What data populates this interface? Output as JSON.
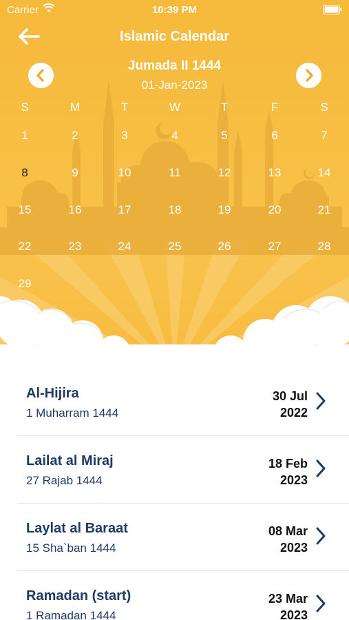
{
  "status": {
    "carrier": "Carrier",
    "time": "10:39 PM"
  },
  "header": {
    "title": "Islamic Calendar"
  },
  "month": {
    "hijri": "Jumada II 1444",
    "gregorian": "01-Jan-2023"
  },
  "weekdays": [
    "S",
    "M",
    "T",
    "W",
    "T",
    "F",
    "S"
  ],
  "days": [
    "1",
    "2",
    "3",
    "4",
    "5",
    "6",
    "7",
    "8",
    "9",
    "10",
    "11",
    "12",
    "13",
    "14",
    "15",
    "16",
    "17",
    "18",
    "19",
    "20",
    "21",
    "22",
    "23",
    "24",
    "25",
    "26",
    "27",
    "28",
    "29"
  ],
  "selected_day": "8",
  "events": [
    {
      "name": "Al-Hijira",
      "hijri": "1 Muharram 1444",
      "date_day_month": "30 Jul",
      "date_year": "2022"
    },
    {
      "name": "Lailat al Miraj",
      "hijri": "27 Rajab 1444",
      "date_day_month": "18 Feb",
      "date_year": "2023"
    },
    {
      "name": "Laylat al Baraat",
      "hijri": "15 Sha`ban 1444",
      "date_day_month": "08 Mar",
      "date_year": "2023"
    },
    {
      "name": "Ramadan (start)",
      "hijri": "1 Ramadan 1444",
      "date_day_month": "23 Mar",
      "date_year": "2023"
    }
  ],
  "colors": {
    "accent": "#f7bc42",
    "title_text": "#1f3a63",
    "white": "#ffffff"
  }
}
